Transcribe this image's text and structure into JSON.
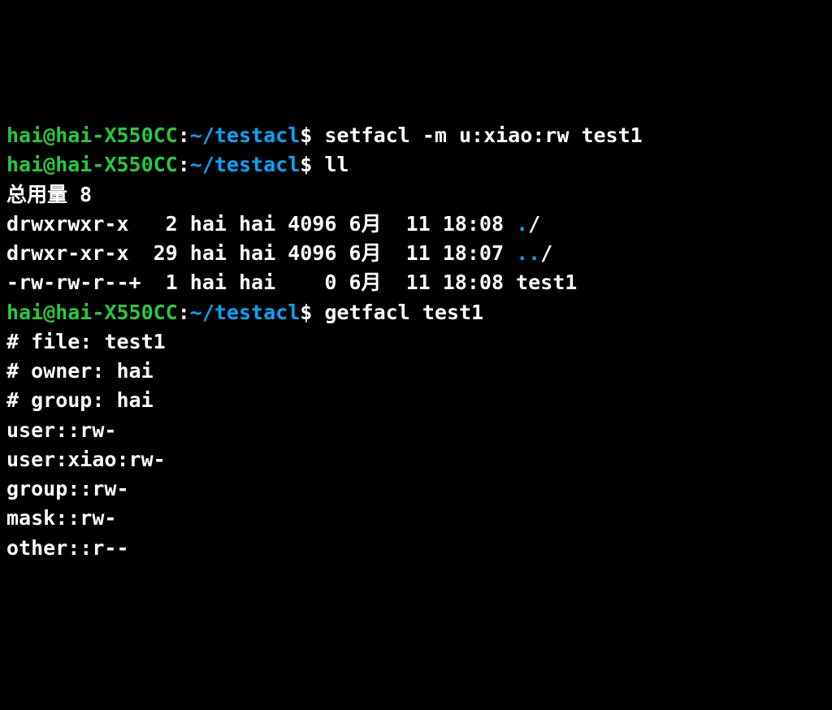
{
  "prompt": {
    "user": "hai@hai-X550CC",
    "path": "~/testacl",
    "sep1": ":",
    "sep2": "$"
  },
  "cmd1": "setfacl -m u:xiao:rw test1",
  "cmd2": "ll",
  "ll_output": {
    "total": "总用量 8",
    "row1_a": "drwxrwxr-x   2 hai hai 4096 6月  11 18:08 ",
    "row1_dot": ".",
    "row1_b": "/",
    "row2_a": "drwxr-xr-x  29 hai hai 4096 6月  11 18:07 ",
    "row2_dot": "..",
    "row2_b": "/",
    "row3": "-rw-rw-r--+  1 hai hai    0 6月  11 18:08 test1"
  },
  "cmd3": "getfacl test1",
  "facl": {
    "l1": "# file: test1",
    "l2": "# owner: hai",
    "l3": "# group: hai",
    "l4": "user::rw-",
    "l5": "user:xiao:rw-",
    "l6": "group::rw-",
    "l7": "mask::rw-",
    "l8": "other::r--"
  }
}
